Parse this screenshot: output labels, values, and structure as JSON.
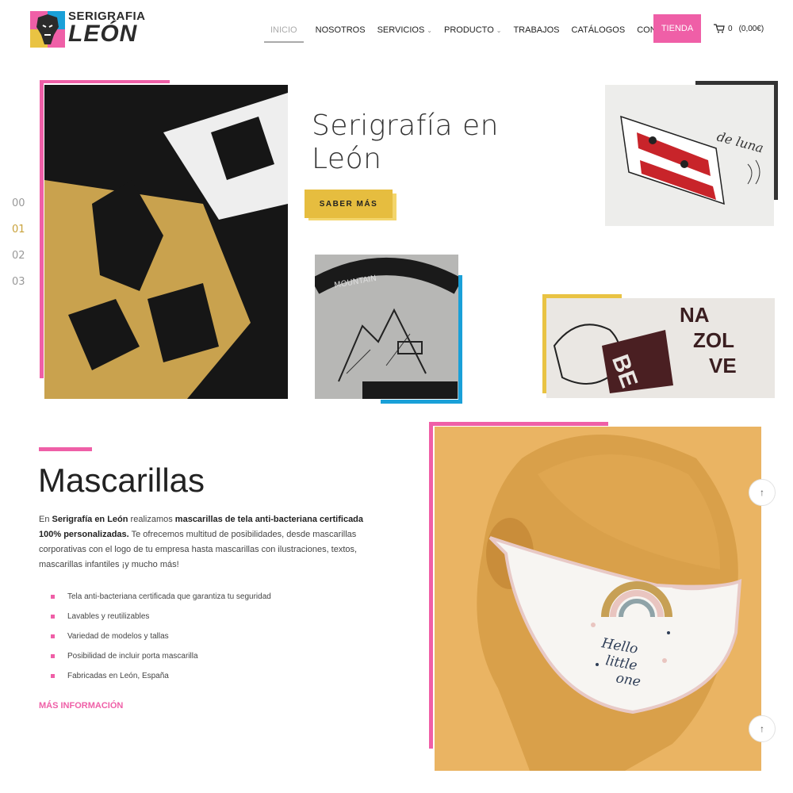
{
  "logo": {
    "line1": "SERIGRAFIA",
    "line2": "LEÓN"
  },
  "nav": {
    "items": [
      {
        "label": "INICIO",
        "active": true,
        "dropdown": false
      },
      {
        "label": "NOSOTROS",
        "active": false,
        "dropdown": false
      },
      {
        "label": "SERVICIOS",
        "active": false,
        "dropdown": true
      },
      {
        "label": "PRODUCTO",
        "active": false,
        "dropdown": true
      },
      {
        "label": "TRABAJOS",
        "active": false,
        "dropdown": false
      },
      {
        "label": "CATÁLOGOS",
        "active": false,
        "dropdown": false
      },
      {
        "label": "CONTACTO",
        "active": false,
        "dropdown": false
      }
    ],
    "shop_label": "TIENDA",
    "cart": {
      "count": "0",
      "total": "(0,00€)"
    }
  },
  "slider": {
    "counter": [
      "00",
      "01",
      "02",
      "03"
    ],
    "active_index": 1,
    "title_line1": "Serigrafía en",
    "title_line2": "León",
    "button_label": "SABER MÁS"
  },
  "mascarillas": {
    "title": "Mascarillas",
    "paragraph": {
      "p1": "En ",
      "b1": "Serigrafía en León",
      "p2": " realizamos ",
      "b2": "mascarillas de tela anti-bacteriana certificada 100% personalizadas.",
      "p3": " Te ofrecemos multitud de posibilidades, desde mascarillas corporativas con el logo de tu empresa hasta mascarillas con ilustraciones, textos, mascarillas infantiles ¡y mucho más!"
    },
    "bullets": [
      "Tela anti-bacteriana certificada que garantiza tu seguridad",
      "Lavables y reutilizables",
      "Variedad de modelos y tallas",
      "Posibilidad de incluir porta mascarilla",
      "Fabricadas en León, España"
    ],
    "more_link": "MÁS INFORMACIÓN",
    "mask_print": [
      "Hello",
      "little",
      "one"
    ]
  },
  "colors": {
    "pink": "#ef5fa7",
    "yellow": "#e6bd3f",
    "blue": "#1aa0d8",
    "dark": "#333333"
  },
  "icons": {
    "cart": "cart-icon",
    "scroll_top": "arrow-up-icon"
  }
}
